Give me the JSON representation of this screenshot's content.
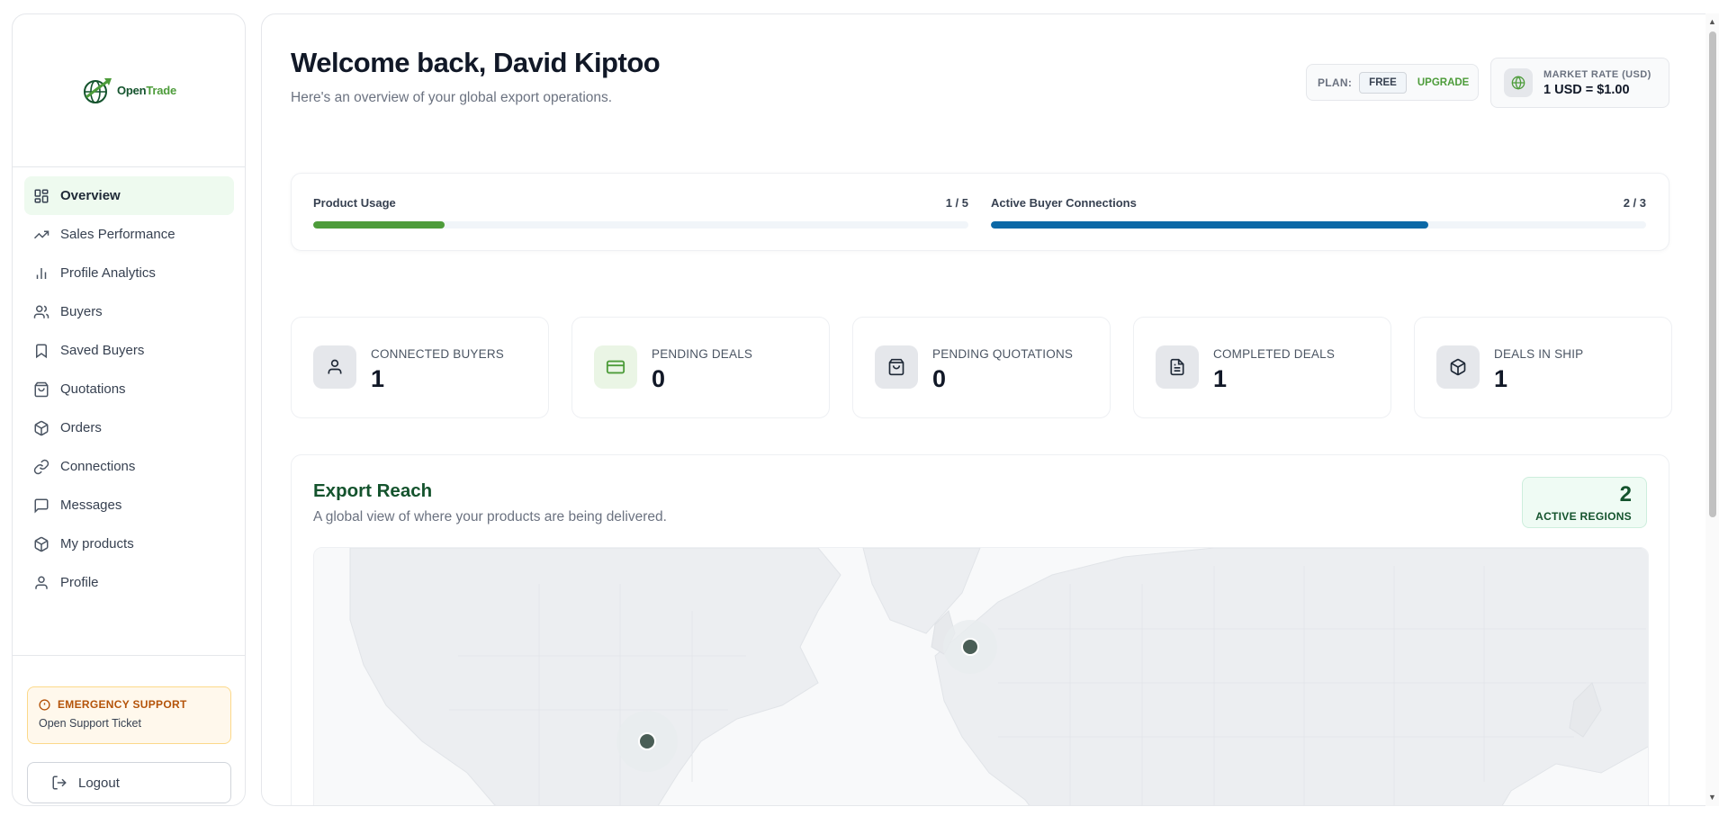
{
  "brand": {
    "name_part1": "Open",
    "name_part2": "Trade"
  },
  "sidebar": {
    "items": [
      {
        "label": "Overview",
        "icon": "layout-grid-icon",
        "active": true
      },
      {
        "label": "Sales Performance",
        "icon": "trending-up-icon"
      },
      {
        "label": "Profile Analytics",
        "icon": "bar-chart-icon"
      },
      {
        "label": "Buyers",
        "icon": "users-icon"
      },
      {
        "label": "Saved Buyers",
        "icon": "bookmark-icon"
      },
      {
        "label": "Quotations",
        "icon": "shopping-bag-icon"
      },
      {
        "label": "Orders",
        "icon": "package-icon"
      },
      {
        "label": "Connections",
        "icon": "link-icon"
      },
      {
        "label": "Messages",
        "icon": "message-square-icon"
      },
      {
        "label": "My products",
        "icon": "package-icon"
      },
      {
        "label": "Profile",
        "icon": "user-icon"
      }
    ],
    "emergency": {
      "title": "EMERGENCY SUPPORT",
      "link": "Open Support Ticket"
    },
    "logout": "Logout"
  },
  "header": {
    "title": "Welcome back, David Kiptoo",
    "subtitle": "Here's an overview of your global export operations.",
    "plan": {
      "label": "PLAN:",
      "value": "FREE",
      "upgrade": "UPGRADE"
    },
    "market_rate": {
      "label": "MARKET RATE (USD)",
      "value": "1 USD = $1.00"
    }
  },
  "usage": [
    {
      "label": "Product Usage",
      "count": "1 / 5",
      "fraction": 0.2,
      "color": "#4d9c3a"
    },
    {
      "label": "Active Buyer Connections",
      "count": "2 / 3",
      "fraction": 0.667,
      "color": "#0b68a6"
    }
  ],
  "stats": [
    {
      "label": "CONNECTED BUYERS",
      "value": "1",
      "icon": "user-icon"
    },
    {
      "label": "PENDING DEALS",
      "value": "0",
      "icon": "credit-card-icon"
    },
    {
      "label": "PENDING QUOTATIONS",
      "value": "0",
      "icon": "shopping-bag-icon"
    },
    {
      "label": "COMPLETED DEALS",
      "value": "1",
      "icon": "file-text-icon"
    },
    {
      "label": "DEALS IN SHIP",
      "value": "1",
      "icon": "package-icon"
    }
  ],
  "export_reach": {
    "title": "Export Reach",
    "subtitle": "A global view of where your products are being delivered.",
    "active_regions": {
      "count": "2",
      "label": "ACTIVE REGIONS"
    },
    "map_markers": [
      "United States",
      "United Kingdom"
    ]
  }
}
